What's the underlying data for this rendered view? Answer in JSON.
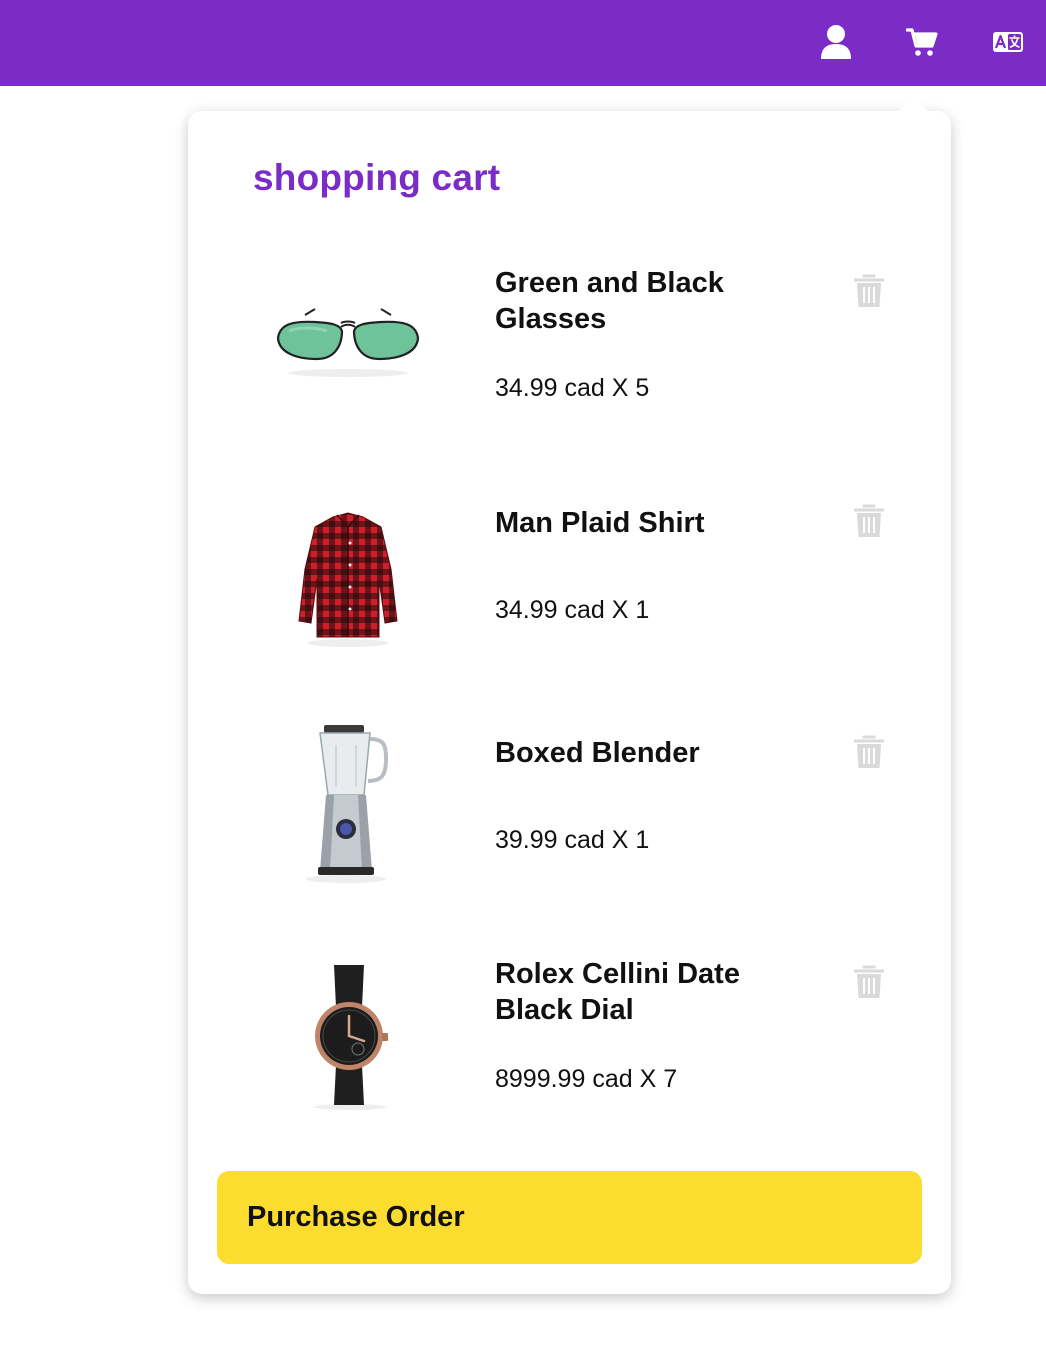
{
  "header": {
    "background": "#7B2BC6",
    "icons": [
      "user-icon",
      "cart-icon",
      "language-icon"
    ]
  },
  "cart": {
    "title": "shopping cart",
    "items": [
      {
        "name": "Green and Black Glasses",
        "price_text": "34.99 cad X 5",
        "image": "sunglasses"
      },
      {
        "name": "Man Plaid Shirt",
        "price_text": "34.99 cad X 1",
        "image": "plaid-shirt"
      },
      {
        "name": "Boxed Blender",
        "price_text": "39.99 cad X 1",
        "image": "blender"
      },
      {
        "name": "Rolex Cellini Date Black Dial",
        "price_text": "8999.99 cad X 7",
        "image": "wristwatch"
      }
    ],
    "purchase_label": "Purchase Order",
    "purchase_color": "#FDDC30"
  }
}
